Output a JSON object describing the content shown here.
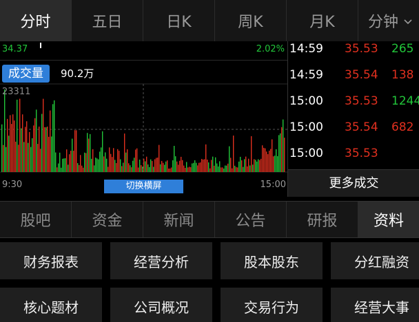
{
  "top_tabs": [
    {
      "label": "分时",
      "active": true
    },
    {
      "label": "五日",
      "active": false
    },
    {
      "label": "日K",
      "active": false
    },
    {
      "label": "周K",
      "active": false
    },
    {
      "label": "月K",
      "active": false
    },
    {
      "label": "分钟",
      "active": false
    }
  ],
  "chart": {
    "price_left": "34.37",
    "pct_right": "2.02%",
    "volume_label": "成交量",
    "volume_value": "90.2万",
    "volume_max": "23311",
    "time_start": "9:30",
    "time_end": "15:00",
    "switch_label": "切换横屏",
    "colors": {
      "up": "#e0301f",
      "down": "#22c63a"
    }
  },
  "trades": {
    "rows": [
      {
        "time": "14:59",
        "price": "35.53",
        "volume": "265",
        "dir": "down"
      },
      {
        "time": "14:59",
        "price": "35.54",
        "volume": "138",
        "dir": "up"
      },
      {
        "time": "15:00",
        "price": "35.53",
        "volume": "1244",
        "dir": "down"
      },
      {
        "time": "15:00",
        "price": "35.54",
        "volume": "682",
        "dir": "up"
      },
      {
        "time": "15:00",
        "price": "35.53",
        "volume": "",
        "dir": "down"
      }
    ],
    "more_label": "更多成交"
  },
  "mid_tabs": [
    {
      "label": "股吧",
      "active": false
    },
    {
      "label": "资金",
      "active": false
    },
    {
      "label": "新闻",
      "active": false
    },
    {
      "label": "公告",
      "active": false
    },
    {
      "label": "研报",
      "active": false
    },
    {
      "label": "资料",
      "active": true
    }
  ],
  "grid_buttons": [
    "财务报表",
    "经营分析",
    "股本股东",
    "分红融资",
    "核心题材",
    "公司概况",
    "交易行为",
    "经营大事"
  ]
}
